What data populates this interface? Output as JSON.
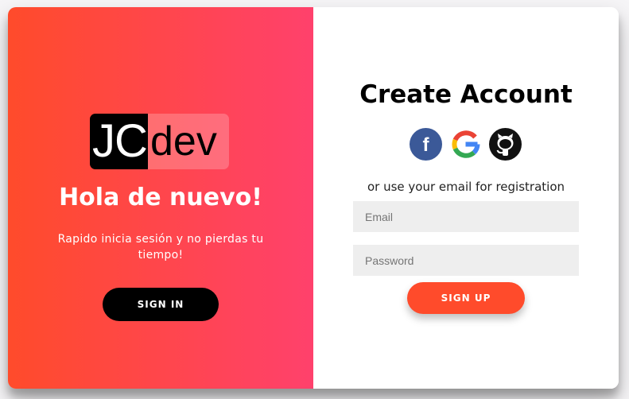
{
  "colors": {
    "accent": "#ff4b2b",
    "gradient_start": "#ff4b2b",
    "gradient_end": "#ff416c",
    "facebook": "#3b5998",
    "github": "#111111",
    "input_bg": "#eeeeee"
  },
  "overlay": {
    "logo_part1": "JC",
    "logo_part2": "dev",
    "title": "Hola de nuevo!",
    "text": "Rapido inicia sesión y no pierdas tu tiempo!",
    "signin_label": "SIGN IN"
  },
  "form": {
    "title": "Create Account",
    "social_icons": [
      "facebook-icon",
      "google-icon",
      "github-icon"
    ],
    "registration_text": "or use your email for registration",
    "email_placeholder": "Email",
    "password_placeholder": "Password",
    "signup_label": "SIGN UP"
  }
}
